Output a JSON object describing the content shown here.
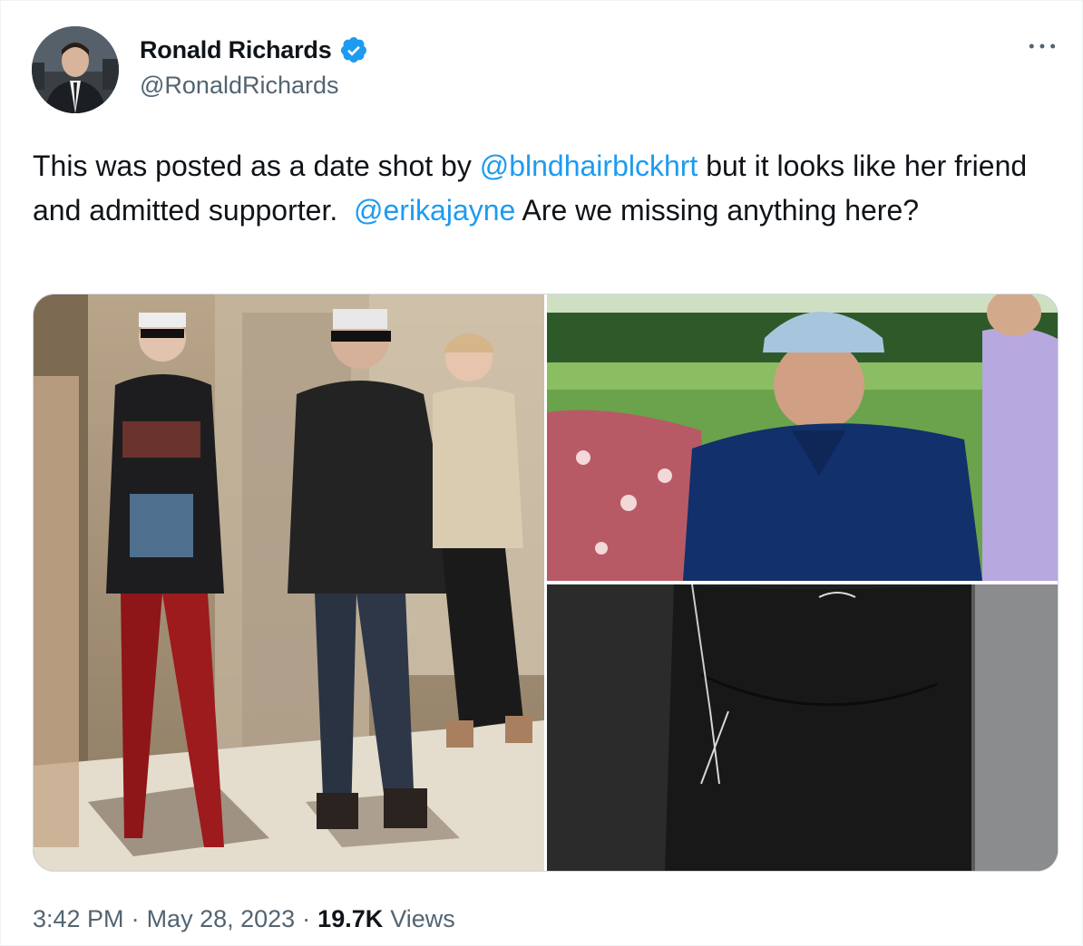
{
  "tweet": {
    "author": {
      "display_name": "Ronald Richards",
      "handle": "@RonaldRichards",
      "verified": true,
      "verified_color": "#1d9bf0"
    },
    "text_parts": {
      "p1": "This was posted as a date shot by ",
      "mention1": "@blndhairblckhrt",
      "p2": " but it looks like her friend and admitted supporter.  ",
      "mention2": "@erikajayne",
      "p3": " Are we missing anything here?"
    },
    "meta": {
      "time": "3:42 PM",
      "separator": "·",
      "date": "May 28, 2023",
      "views_count": "19.7K",
      "views_label": "Views"
    },
    "more_icon": "more-horizontal-icon"
  },
  "colors": {
    "text": "#0f1419",
    "secondary": "#536471",
    "link": "#1d9bf0"
  }
}
